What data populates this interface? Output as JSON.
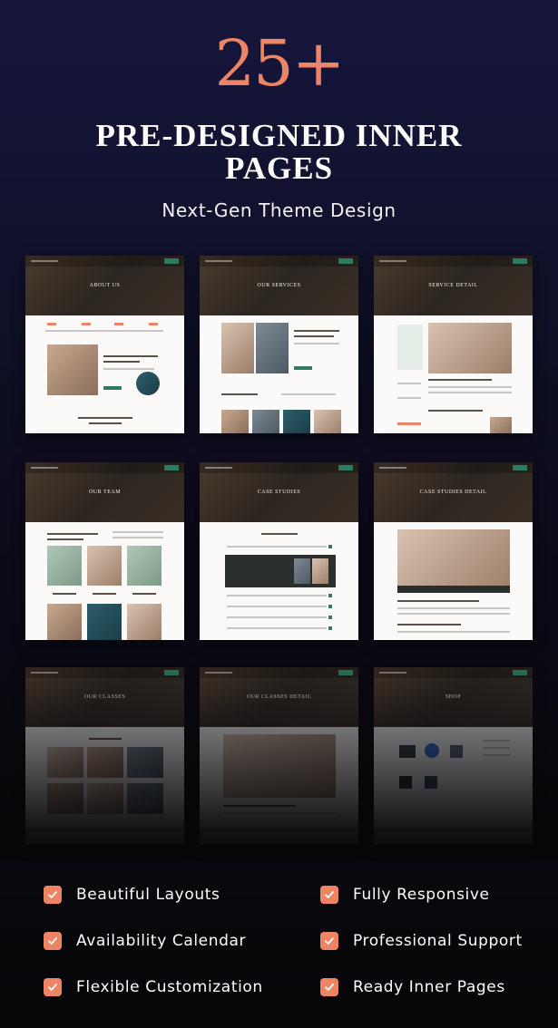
{
  "hero": {
    "count": "25+",
    "title_line1": "PRE-DESIGNED INNER",
    "title_line2": "PAGES",
    "subtitle": "Next-Gen Theme Design"
  },
  "pages": [
    {
      "name": "ABOUT US"
    },
    {
      "name": "OUR SERVICES"
    },
    {
      "name": "SERVICE DETAIL"
    },
    {
      "name": "OUR TEAM"
    },
    {
      "name": "CASE STUDIES"
    },
    {
      "name": "CASE STUDIES DETAIL"
    },
    {
      "name": "OUR CLASSES"
    },
    {
      "name": "OUR CLASSES DETAIL"
    },
    {
      "name": "SHOP"
    }
  ],
  "features": [
    {
      "label": "Beautiful Layouts",
      "icon": "check-icon"
    },
    {
      "label": "Fully Responsive",
      "icon": "check-icon"
    },
    {
      "label": "Availability Calendar",
      "icon": "check-icon"
    },
    {
      "label": "Professional Support",
      "icon": "check-icon"
    },
    {
      "label": "Flexible Customization",
      "icon": "check-icon"
    },
    {
      "label": "Ready Inner Pages",
      "icon": "check-icon"
    }
  ],
  "colors": {
    "accent": "#ee8466",
    "brand_green": "#2e7a63",
    "background_top": "#16163d",
    "background_bottom": "#060608"
  }
}
